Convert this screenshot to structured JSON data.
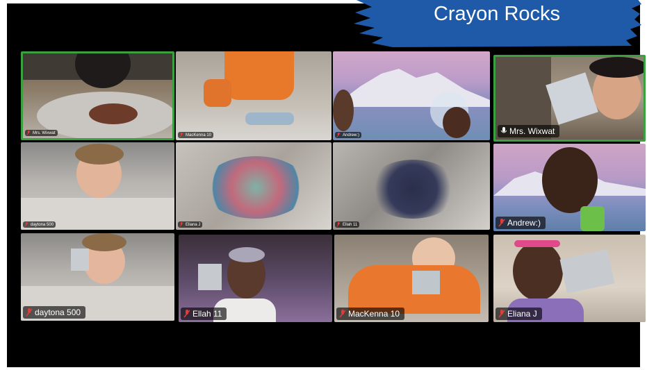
{
  "banner": {
    "title": "Crayon Rocks",
    "color": "#1f5aa8"
  },
  "meeting": {
    "active_speaker_color": "#3aa040",
    "muted_icon": "muted-mic-icon",
    "participants": [
      {
        "name": "Mrs. Wixwat",
        "muted": true,
        "active": true
      },
      {
        "name": "MacKenna 10",
        "muted": true,
        "active": false
      },
      {
        "name": "Andrew:)",
        "muted": true,
        "active": false
      },
      {
        "name": "Mrs. Wixwat",
        "muted": false,
        "active": true
      },
      {
        "name": "daytona 500",
        "muted": true,
        "active": false
      },
      {
        "name": "Eliana J",
        "muted": true,
        "active": false
      },
      {
        "name": "Ellah 11",
        "muted": true,
        "active": false
      },
      {
        "name": "Andrew:)",
        "muted": true,
        "active": false
      },
      {
        "name": "daytona 500",
        "muted": true,
        "active": false
      },
      {
        "name": "Ellah 11",
        "muted": true,
        "active": false
      },
      {
        "name": "MacKenna 10",
        "muted": true,
        "active": false
      },
      {
        "name": "Eliana J",
        "muted": true,
        "active": false
      }
    ]
  }
}
